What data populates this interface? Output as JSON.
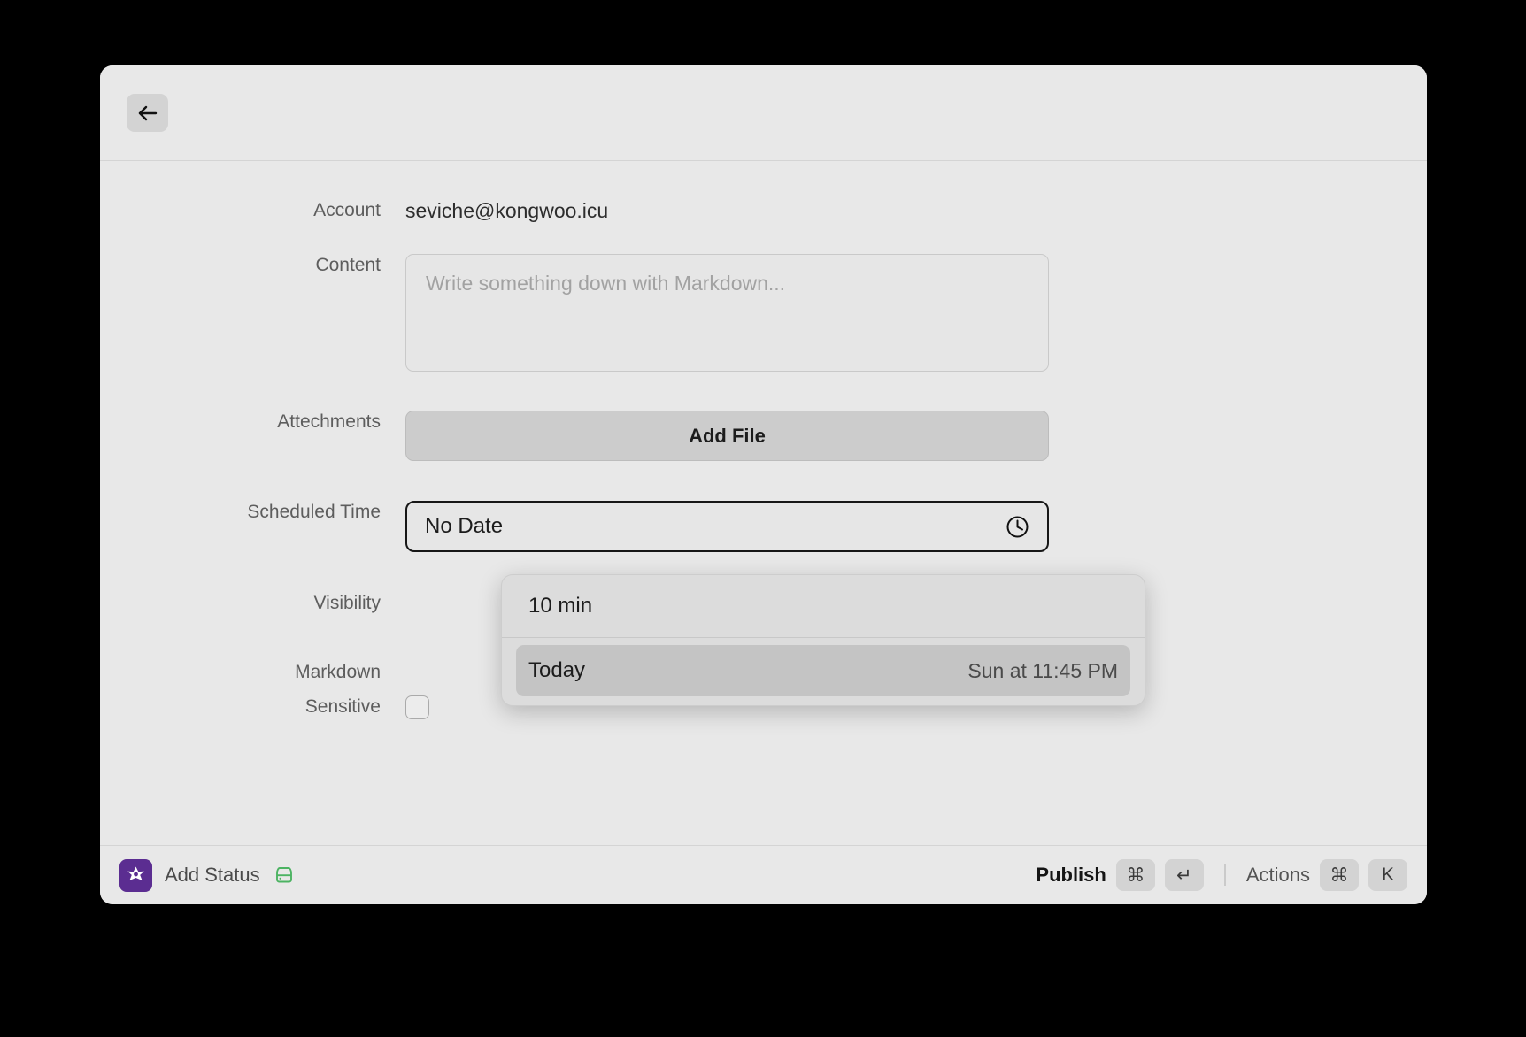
{
  "window": {
    "back_button_icon": "arrow-left-icon"
  },
  "form": {
    "account": {
      "label": "Account",
      "value": "seviche@kongwoo.icu"
    },
    "content": {
      "label": "Content",
      "placeholder": "Write something down with Markdown...",
      "value": ""
    },
    "attachments": {
      "label": "Attechments",
      "add_file_label": "Add File"
    },
    "scheduled_time": {
      "label": "Scheduled Time",
      "value": "No Date",
      "icon": "clock-icon"
    },
    "visibility": {
      "label": "Visibility"
    },
    "markdown": {
      "label": "Markdown"
    },
    "sensitive": {
      "label": "Sensitive",
      "checked": false
    }
  },
  "dropdown": {
    "items": [
      {
        "label": "10 min",
        "trailing": "",
        "selected": false
      },
      {
        "label": "Today",
        "trailing": "Sun at 11:45 PM",
        "selected": true
      }
    ]
  },
  "toolbar": {
    "app_icon": "mastodon-app-icon",
    "title": "Add Status",
    "drive_icon": "hard-drive-icon",
    "publish_label": "Publish",
    "publish_keys": [
      "⌘",
      "↵"
    ],
    "actions_label": "Actions",
    "actions_keys": [
      "⌘",
      "K"
    ]
  },
  "colors": {
    "window_bg": "#e8e8e8",
    "accent_purple": "#5b2d91",
    "accent_green": "#4cb362",
    "focus_border": "#171717"
  }
}
